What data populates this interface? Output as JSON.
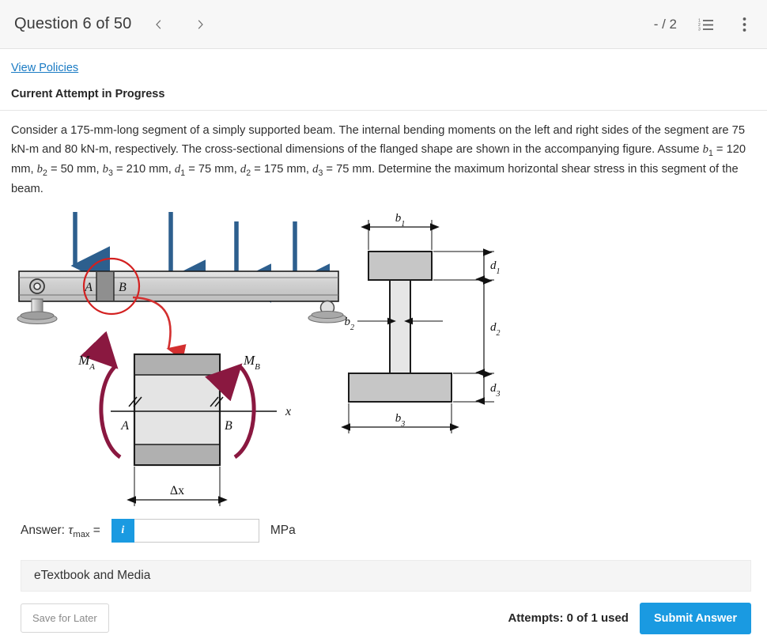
{
  "header": {
    "question_title": "Question 6 of 50",
    "prev_icon": "chevron-left-icon",
    "next_icon": "chevron-right-icon",
    "score": "- / 2",
    "list_icon": "numbered-list-icon",
    "menu_icon": "kebab-menu-icon"
  },
  "links": {
    "view_policies": "View Policies"
  },
  "status": {
    "attempt": "Current Attempt in Progress"
  },
  "question": {
    "part1": "Consider a 175-mm-long segment of a simply supported beam. The internal bending moments on the left and right sides of the segment are 75 kN-m and 80 kN-m, respectively. The cross-sectional dimensions of the flanged shape are shown in the accompanying figure. Assume ",
    "b1_sym": "b",
    "b1_sub": "1",
    "b1_val": " = 120 mm, ",
    "b2_sym": "b",
    "b2_sub": "2",
    "b2_val": " = 50 mm, ",
    "b3_sym": "b",
    "b3_sub": "3",
    "b3_val": " = 210 mm, ",
    "d1_sym": "d",
    "d1_sub": "1",
    "d1_val": " = 75 mm, ",
    "d2_sym": "d",
    "d2_sub": "2",
    "d2_val": " = 175 mm, ",
    "d3_sym": "d",
    "d3_sub": "3",
    "d3_val": " = 75 mm. Determine the maximum horizontal shear stress in this segment of the beam."
  },
  "figure": {
    "beam_label_a": "A",
    "beam_label_b": "B",
    "moment_a": "M",
    "moment_a_sub": "A",
    "moment_b": "M",
    "moment_b_sub": "B",
    "segment_label_a": "A",
    "segment_label_b": "B",
    "axis_x": "x",
    "delta_x": "Δx",
    "dim_b1": "b",
    "dim_b1_sub": "1",
    "dim_b2": "b",
    "dim_b2_sub": "2",
    "dim_b3": "b",
    "dim_b3_sub": "3",
    "dim_d1": "d",
    "dim_d1_sub": "1",
    "dim_d2": "d",
    "dim_d2_sub": "2",
    "dim_d3": "d",
    "dim_d3_sub": "3",
    "load_arrow_count": 4,
    "colors": {
      "load_arrow": "#2d5f8e",
      "highlight_circle": "#d32020",
      "leader_arrow": "#d32f2f",
      "moment_arrow": "#8a1840",
      "beam_fill": "#d4d4d4",
      "flange_fill": "#c6c6c6",
      "web_fill": "#e2e2e2"
    }
  },
  "answer": {
    "label_prefix": "Answer: ",
    "symbol": "τ",
    "symbol_sub": "max",
    "equals": " = ",
    "info_label": "i",
    "value": "",
    "placeholder": "",
    "unit": "MPa"
  },
  "etextbook": {
    "label": "eTextbook and Media"
  },
  "footer": {
    "save_label": "Save for Later",
    "attempts": "Attempts: 0 of 1 used",
    "submit_label": "Submit Answer"
  }
}
